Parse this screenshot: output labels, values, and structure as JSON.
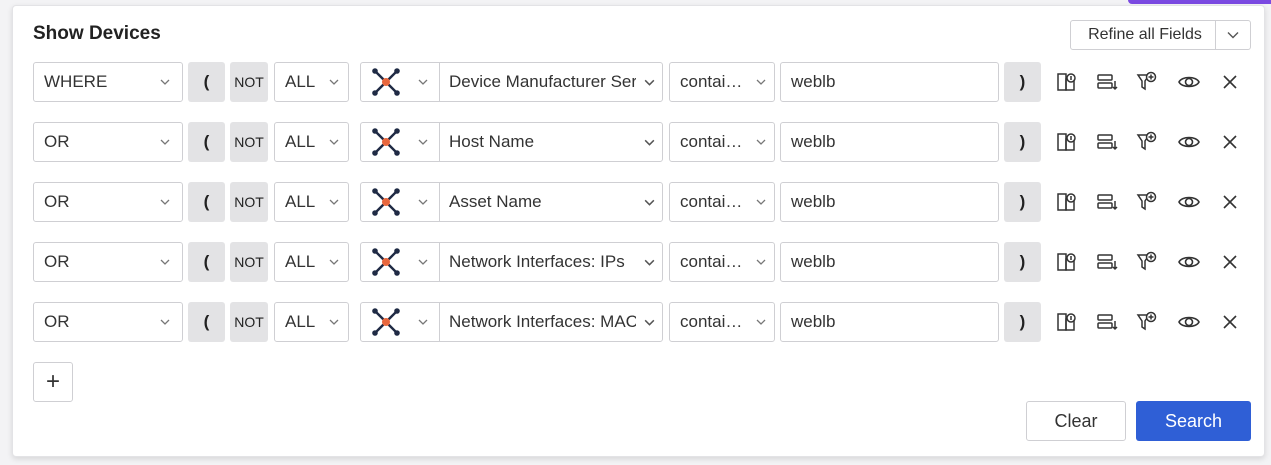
{
  "header": {
    "title": "Show Devices",
    "refine_label": "Refine all Fields"
  },
  "filters": [
    {
      "logic": "WHERE",
      "open_paren": "(",
      "not_label": "NOT",
      "scope": "ALL",
      "adapter_icon": "adapter-connector-icon",
      "field": "Device Manufacturer Ser",
      "operator": "contai…",
      "value": "weblb",
      "close_paren": ")"
    },
    {
      "logic": "OR",
      "open_paren": "(",
      "not_label": "NOT",
      "scope": "ALL",
      "adapter_icon": "adapter-connector-icon",
      "field": "Host Name",
      "operator": "contai…",
      "value": "weblb",
      "close_paren": ")"
    },
    {
      "logic": "OR",
      "open_paren": "(",
      "not_label": "NOT",
      "scope": "ALL",
      "adapter_icon": "adapter-connector-icon",
      "field": "Asset Name",
      "operator": "contai…",
      "value": "weblb",
      "close_paren": ")"
    },
    {
      "logic": "OR",
      "open_paren": "(",
      "not_label": "NOT",
      "scope": "ALL",
      "adapter_icon": "adapter-connector-icon",
      "field": "Network Interfaces: IPs",
      "operator": "contai…",
      "value": "weblb",
      "close_paren": ")"
    },
    {
      "logic": "OR",
      "open_paren": "(",
      "not_label": "NOT",
      "scope": "ALL",
      "adapter_icon": "adapter-connector-icon",
      "field": "Network Interfaces: MAC",
      "operator": "contai…",
      "value": "weblb",
      "close_paren": ")"
    }
  ],
  "row_actions": [
    "field-compare-icon",
    "move-rows-icon",
    "add-filter-icon",
    "preview-eye-icon",
    "remove-close-icon"
  ],
  "footer": {
    "add_label": "+",
    "clear_label": "Clear",
    "search_label": "Search"
  },
  "colors": {
    "accent": "#2f5fd6",
    "adapter_dot": "#e8663d",
    "adapter_node": "#1f2a44"
  }
}
